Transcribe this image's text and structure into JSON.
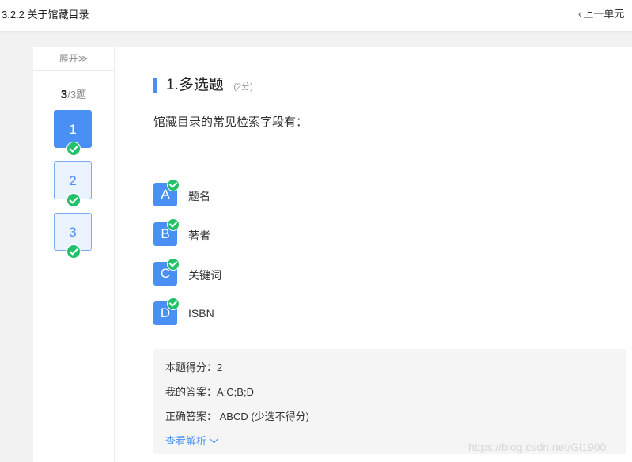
{
  "header": {
    "title": "3.2.2 关于馆藏目录",
    "prev_label": "上一单元",
    "prev_icon": "chevron-left-icon"
  },
  "sidebar": {
    "expand_label": "展开≫",
    "progress_done": "3",
    "progress_total": "/3题",
    "questions": [
      {
        "number": "1",
        "state": "active",
        "answered": true
      },
      {
        "number": "2",
        "state": "normal",
        "answered": true
      },
      {
        "number": "3",
        "state": "normal",
        "answered": true
      }
    ]
  },
  "question": {
    "title": "1.多选题",
    "score": "(2分)",
    "stem": "馆藏目录的常见检索字段有：",
    "options": [
      {
        "letter": "A",
        "text": "题名",
        "selected": true
      },
      {
        "letter": "B",
        "text": "著者",
        "selected": true
      },
      {
        "letter": "C",
        "text": "关键词",
        "selected": true
      },
      {
        "letter": "D",
        "text": "ISBN",
        "selected": true
      }
    ]
  },
  "result": {
    "score_label": "本题得分：",
    "score_value": "2",
    "my_answer_label": "我的答案：",
    "my_answer_value": "A;C;B;D",
    "correct_label": "正确答案：",
    "correct_value": " ABCD (少选不得分)",
    "analysis_link": "查看解析"
  },
  "watermark": "https://blog.csdn.net/Gl1900",
  "colors": {
    "accent": "#4a8ff4",
    "check_green": "#23c16b",
    "page_bg": "#f2f2f2"
  }
}
